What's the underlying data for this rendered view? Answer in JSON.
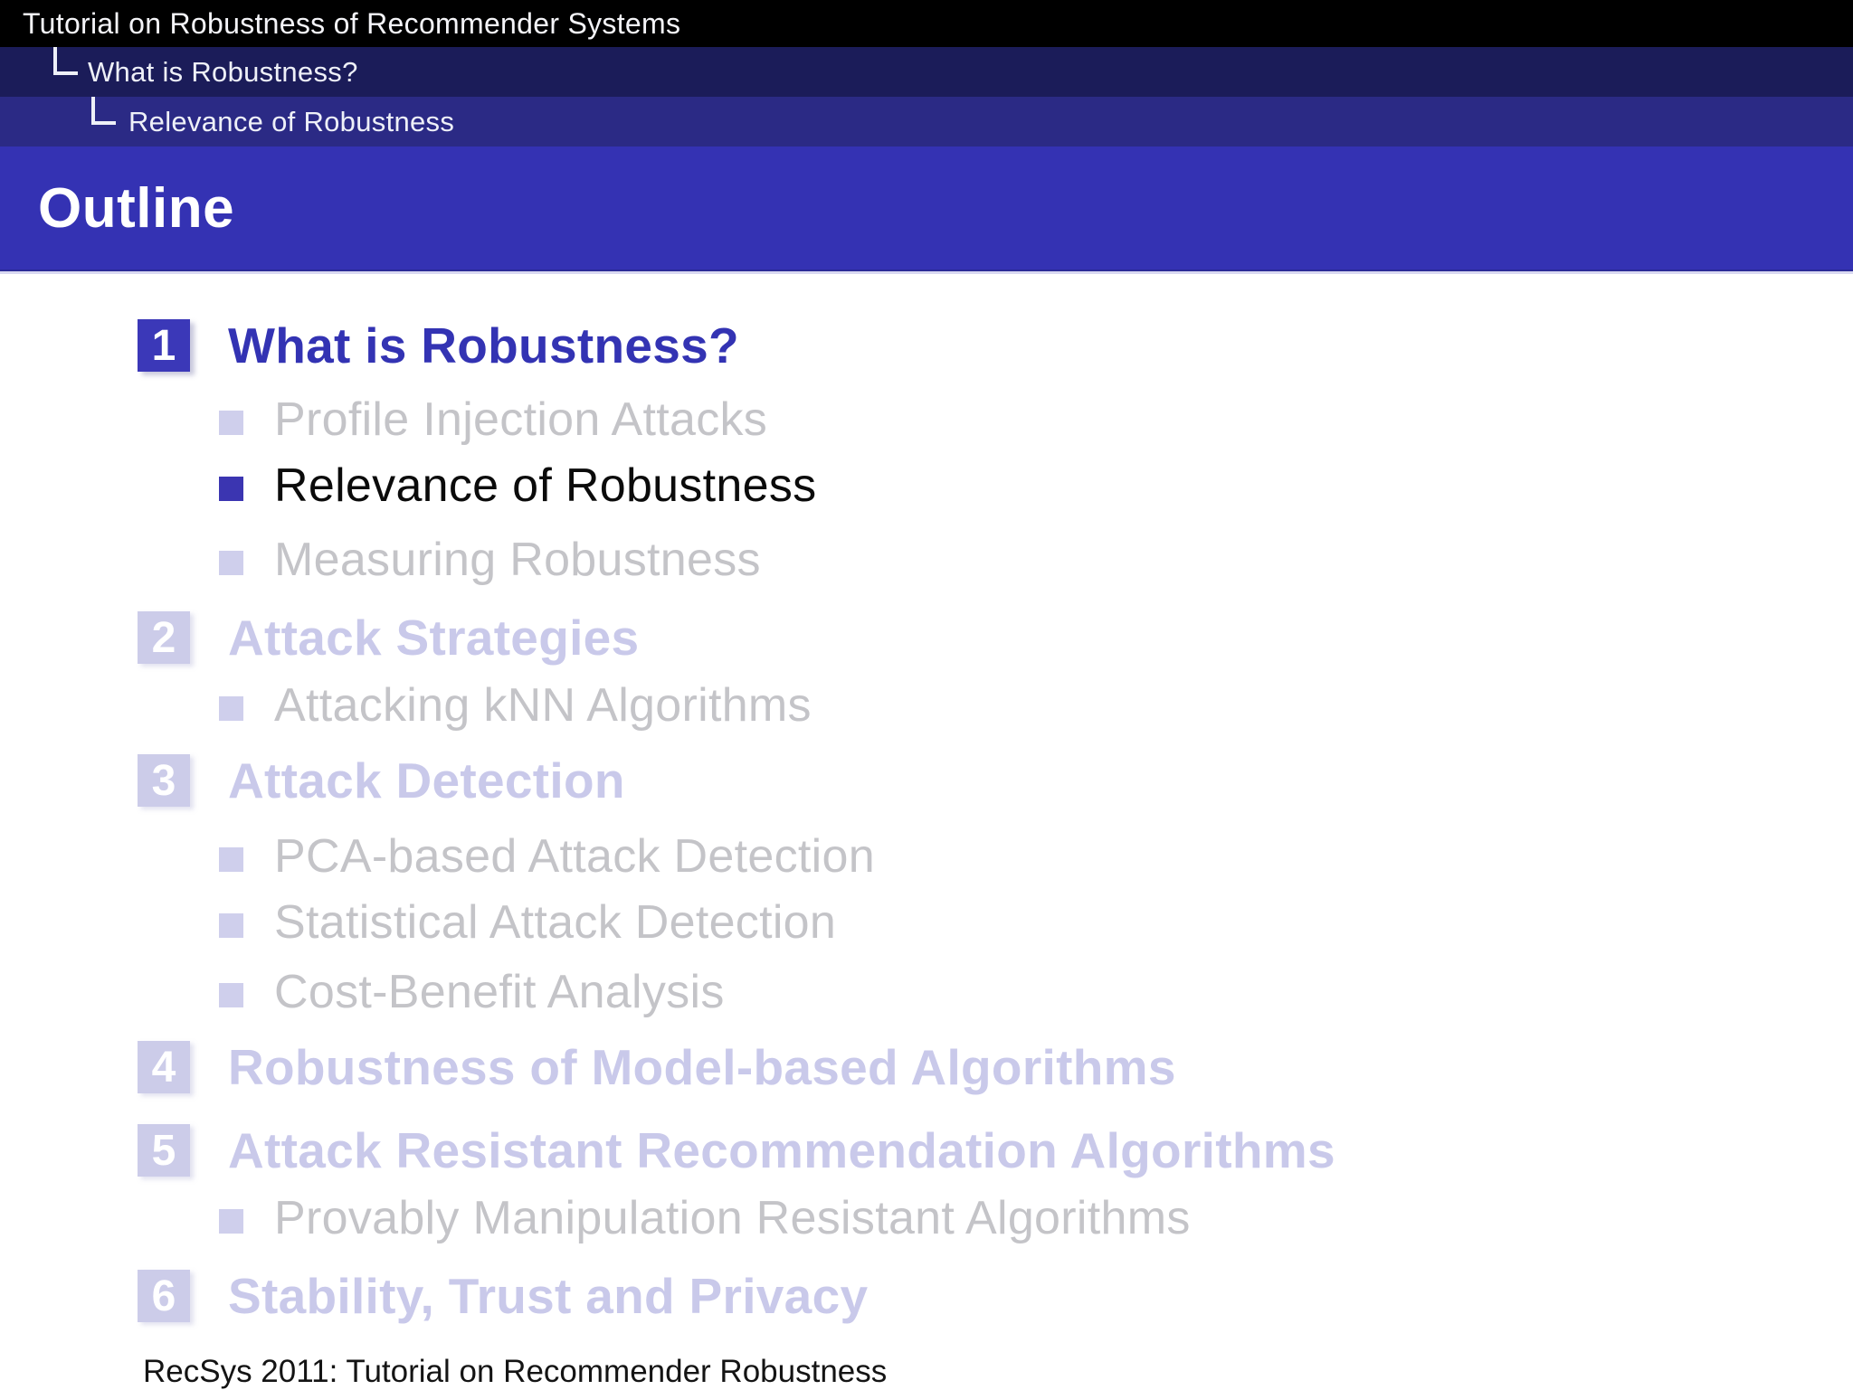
{
  "nav": {
    "title_bar": "Tutorial on Robustness of Recommender Systems",
    "section_bar": "What is Robustness?",
    "subsection_bar": "Relevance of Robustness"
  },
  "frametitle": "Outline",
  "outline": {
    "sections": [
      {
        "number": "1",
        "label": "What is Robustness?",
        "state": "active",
        "subsections": [
          {
            "label": "Profile Injection Attacks",
            "state": "faded"
          },
          {
            "label": "Relevance of Robustness",
            "state": "current"
          },
          {
            "label": "Measuring Robustness",
            "state": "faded"
          }
        ]
      },
      {
        "number": "2",
        "label": "Attack Strategies",
        "state": "faded",
        "subsections": [
          {
            "label": "Attacking kNN Algorithms",
            "state": "faded"
          }
        ]
      },
      {
        "number": "3",
        "label": "Attack Detection",
        "state": "faded",
        "subsections": [
          {
            "label": "PCA-based Attack Detection",
            "state": "faded"
          },
          {
            "label": "Statistical Attack Detection",
            "state": "faded"
          },
          {
            "label": "Cost-Benefit Analysis",
            "state": "faded"
          }
        ]
      },
      {
        "number": "4",
        "label": "Robustness of Model-based Algorithms",
        "state": "faded",
        "subsections": []
      },
      {
        "number": "5",
        "label": "Attack Resistant Recommendation Algorithms",
        "state": "faded",
        "subsections": [
          {
            "label": "Provably Manipulation Resistant Algorithms",
            "state": "faded"
          }
        ]
      },
      {
        "number": "6",
        "label": "Stability, Trust and Privacy",
        "state": "faded",
        "subsections": []
      }
    ]
  },
  "footer": "RecSys 2011: Tutorial on Recommender Robustness",
  "colors": {
    "title_bar_bg": "#000000",
    "section_bar_bg": "#1b1c59",
    "subsection_bar_bg": "#2b2a85",
    "frametitle_bg": "#3432b3",
    "structure_blue": "#3333b3",
    "current_item_text": "#0b0b0b",
    "faded_structure": "#cccce9",
    "faded_text": "#c4c4c8",
    "bar_text": "#eef0f8"
  }
}
